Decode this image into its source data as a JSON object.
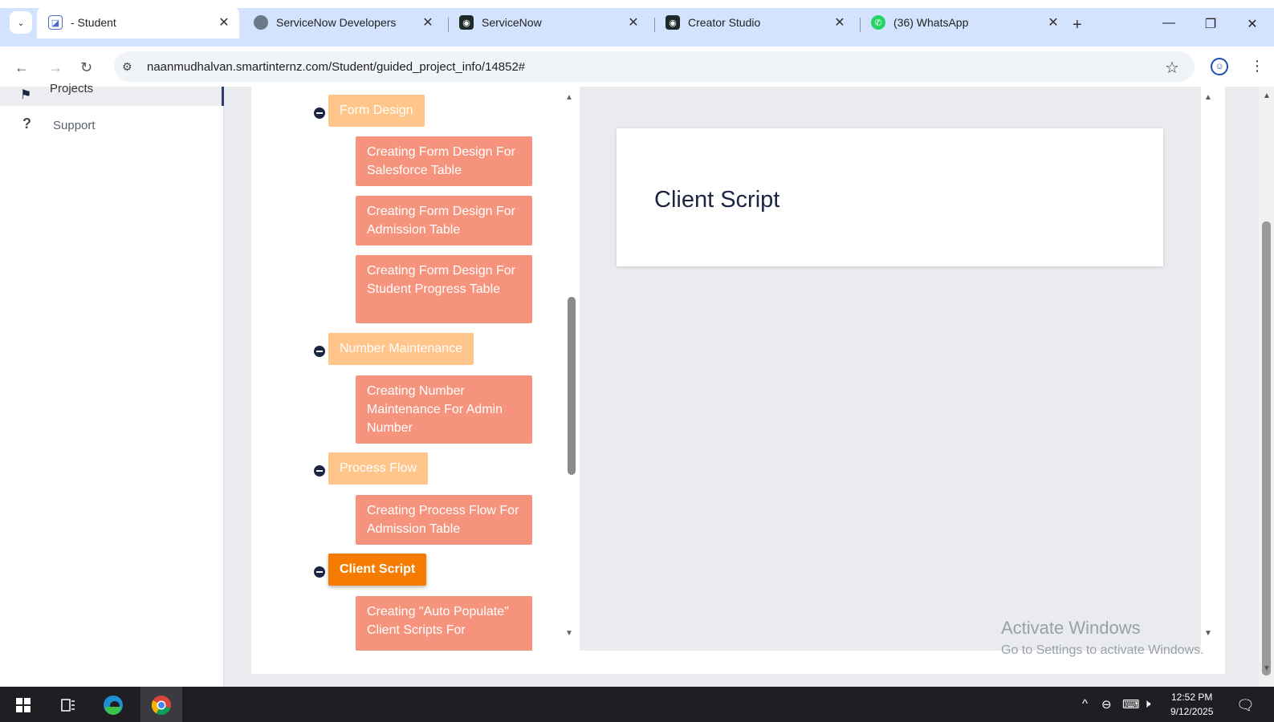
{
  "browser": {
    "tabs": [
      {
        "title": "- Student",
        "favicon": "page-icon",
        "active": true
      },
      {
        "title": "ServiceNow Developers",
        "favicon": "servicenow-dev-icon",
        "active": false
      },
      {
        "title": "ServiceNow",
        "favicon": "servicenow-icon",
        "active": false
      },
      {
        "title": "Creator Studio",
        "favicon": "creator-studio-icon",
        "active": false
      },
      {
        "title": "(36) WhatsApp",
        "favicon": "whatsapp-icon",
        "active": false
      }
    ],
    "url": "naanmudhalvan.smartinternz.com/Student/guided_project_info/14852#",
    "glyphs": {
      "close": "✕",
      "new_tab": "+",
      "minimize": "—",
      "restore": "❐",
      "win_close": "✕",
      "back": "←",
      "forward": "→",
      "reload": "↻",
      "star": "☆",
      "menu": "⋮",
      "dropdown": "⌄",
      "site_info": "⚙"
    }
  },
  "sidebar": {
    "items": [
      {
        "label": "Projects",
        "icon": "bookmark-icon",
        "glyph": "⚑"
      },
      {
        "label": "Support",
        "icon": "question-icon",
        "glyph": "?"
      }
    ]
  },
  "tree": {
    "sections": [
      {
        "label": "Form Design",
        "active": false,
        "children": [
          "Creating Form Design For Salesforce Table",
          "Creating Form Design For Admission Table",
          "Creating Form Design For Student Progress Table"
        ]
      },
      {
        "label": "Number Maintenance",
        "active": false,
        "children": [
          "Creating Number Maintenance For Admin Number"
        ]
      },
      {
        "label": "Process Flow",
        "active": false,
        "children": [
          "Creating Process Flow For Admission Table"
        ]
      },
      {
        "label": "Client Script",
        "active": true,
        "children": [
          "Creating \"Auto Populate\" Client Scripts For"
        ]
      }
    ]
  },
  "content": {
    "title": "Client Script"
  },
  "watermark": {
    "line1": "Activate Windows",
    "line2": "Go to Settings to activate Windows."
  },
  "taskbar": {
    "time": "12:52 PM",
    "date": "9/12/2025",
    "tray_glyphs": {
      "chevron": "^",
      "network": "⌨",
      "volume": "🕨",
      "notifications": "🗨"
    }
  },
  "colors": {
    "section": "#ffc58a",
    "section_active": "#f57c00",
    "leaf": "#f5937d",
    "navy": "#1c2541"
  }
}
